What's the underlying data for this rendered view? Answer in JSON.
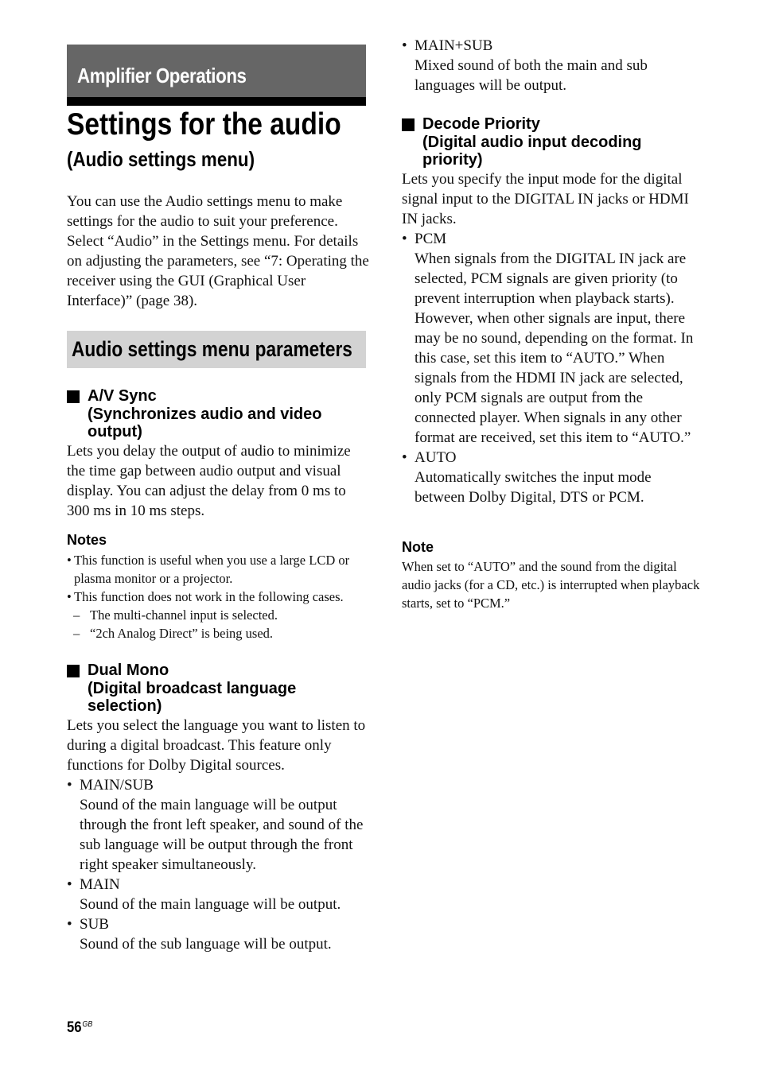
{
  "header": {
    "section": "Amplifier Operations",
    "title": "Settings for the audio",
    "subtitle": "(Audio settings menu)"
  },
  "intro": "You can use the Audio settings menu to make settings for the audio to suit your preference. Select “Audio” in the Settings menu. For details on adjusting the parameters, see “7: Operating the receiver using the GUI (Graphical User Interface)” (page 38).",
  "parameters_heading": "Audio settings menu parameters",
  "av_sync": {
    "title": "A/V Sync",
    "subtitle_line1": "(Synchronizes audio and video",
    "subtitle_line2": "output)",
    "body": "Lets you delay the output of audio to minimize the time gap between audio output and visual display. You can adjust the delay from 0 ms to 300 ms in 10 ms steps.",
    "notes_heading": "Notes",
    "notes": [
      "This function is useful when you use a large LCD or plasma monitor or a projector.",
      "This function does not work in the following cases."
    ],
    "cases": [
      "The multi-channel input is selected.",
      "“2ch Analog Direct” is being used."
    ]
  },
  "dual_mono": {
    "title": "Dual Mono",
    "subtitle_line1": "(Digital broadcast language",
    "subtitle_line2": "selection)",
    "body": "Lets you select the language you want to listen to during a digital broadcast. This feature only functions for Dolby Digital sources.",
    "options": [
      {
        "name": "MAIN/SUB",
        "desc": "Sound of the main language will be output through the front left speaker, and sound of the sub language will be output through the front right speaker simultaneously."
      },
      {
        "name": "MAIN",
        "desc": "Sound of the main language will be output."
      },
      {
        "name": "SUB",
        "desc": "Sound of the sub language will be output."
      },
      {
        "name": "MAIN+SUB",
        "desc": "Mixed sound of both the main and sub languages will be output."
      }
    ]
  },
  "decode_priority": {
    "title": "Decode Priority",
    "subtitle_line1": "(Digital audio input decoding",
    "subtitle_line2": "priority)",
    "body": "Lets you specify the input mode for the digital signal input to the DIGITAL IN jacks or HDMI IN jacks.",
    "options": [
      {
        "name": "PCM",
        "desc": "When signals from the DIGITAL IN jack are selected, PCM signals are given priority (to prevent interruption when playback starts). However, when other signals are input, there may be no sound, depending on the format. In this case, set this item to “AUTO.” When signals from the HDMI IN jack are selected, only PCM signals are output from the connected player. When signals in any other format are received, set this item to “AUTO.”"
      },
      {
        "name": "AUTO",
        "desc": "Automatically switches the input mode between Dolby Digital, DTS or PCM."
      }
    ],
    "note_heading": "Note",
    "note": "When set to “AUTO” and the sound from the digital audio jacks (for a CD, etc.) is interrupted when playback starts, set to “PCM.”"
  },
  "footer": {
    "page_number": "56",
    "page_suffix": "GB"
  }
}
